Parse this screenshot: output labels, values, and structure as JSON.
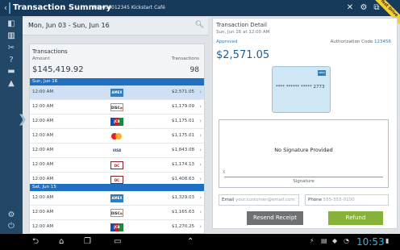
{
  "titlebar": {
    "title": "Transaction Summary",
    "merchant": "MID000012345 Kickstart Café",
    "ribbon": "Test Drive",
    "icons": [
      "close-icon",
      "settings-icon",
      "network-icon"
    ]
  },
  "rail": {
    "icons": [
      "sidebar-toggle-icon",
      "summary-icon",
      "tools-icon",
      "help-icon",
      "more-icon",
      "settings-icon",
      "logout-icon"
    ]
  },
  "datebar": {
    "range": "Mon, Jun 03 - Sun, Jun 16"
  },
  "transactions": {
    "label": "Transactions",
    "amount_label": "Amount",
    "count_label": "Transactions",
    "total": "$145,419.92",
    "count": "98",
    "groups": [
      {
        "day": "Sun, Jun 16",
        "rows": [
          {
            "time": "12:00 AM",
            "card": "amex",
            "amount": "$2,571.05",
            "selected": true
          },
          {
            "time": "12:00 AM",
            "card": "discover",
            "amount": "$1,179.09"
          },
          {
            "time": "12:00 AM",
            "card": "jcb",
            "amount": "$1,175.01"
          },
          {
            "time": "12:00 AM",
            "card": "mastercard",
            "amount": "$1,175.01"
          },
          {
            "time": "12:00 AM",
            "card": "visa",
            "amount": "$1,843.08"
          },
          {
            "time": "12:00 AM",
            "card": "diners",
            "amount": "$1,174.13"
          },
          {
            "time": "12:00 AM",
            "card": "diners",
            "amount": "$1,408.63"
          }
        ]
      },
      {
        "day": "Sat, Jun 15",
        "rows": [
          {
            "time": "12:00 AM",
            "card": "amex",
            "amount": "$1,329.03"
          },
          {
            "time": "12:00 AM",
            "card": "discover",
            "amount": "$1,165.63"
          },
          {
            "time": "12:00 AM",
            "card": "jcb",
            "amount": "$1,270.25"
          }
        ]
      }
    ]
  },
  "detail": {
    "title": "Transaction Detail",
    "date": "Sun, Jun 16 at 12:00 AM",
    "status": "Approved",
    "auth_label": "Authorization Code",
    "auth_code": "123456",
    "amount": "$2,571.05",
    "card_number": "**** ****** ***** 2773",
    "no_signature": "No Signature Provided",
    "signature_x": "X",
    "signature_label": "Signature",
    "email_label": "Email",
    "email_placeholder": "your.customer@email.com",
    "phone_label": "Phone",
    "phone_placeholder": "555-555-0100",
    "resend_label": "Resend Receipt",
    "refund_label": "Refund"
  },
  "sysbar": {
    "time": "10:53",
    "nav_icons": [
      "back-icon",
      "home-icon",
      "recents-icon",
      "screenshot-icon",
      "scroll-icon"
    ],
    "status_icons": [
      "usb-icon",
      "sd-icon",
      "game-icon",
      "wifi-icon",
      "battery-icon"
    ]
  }
}
